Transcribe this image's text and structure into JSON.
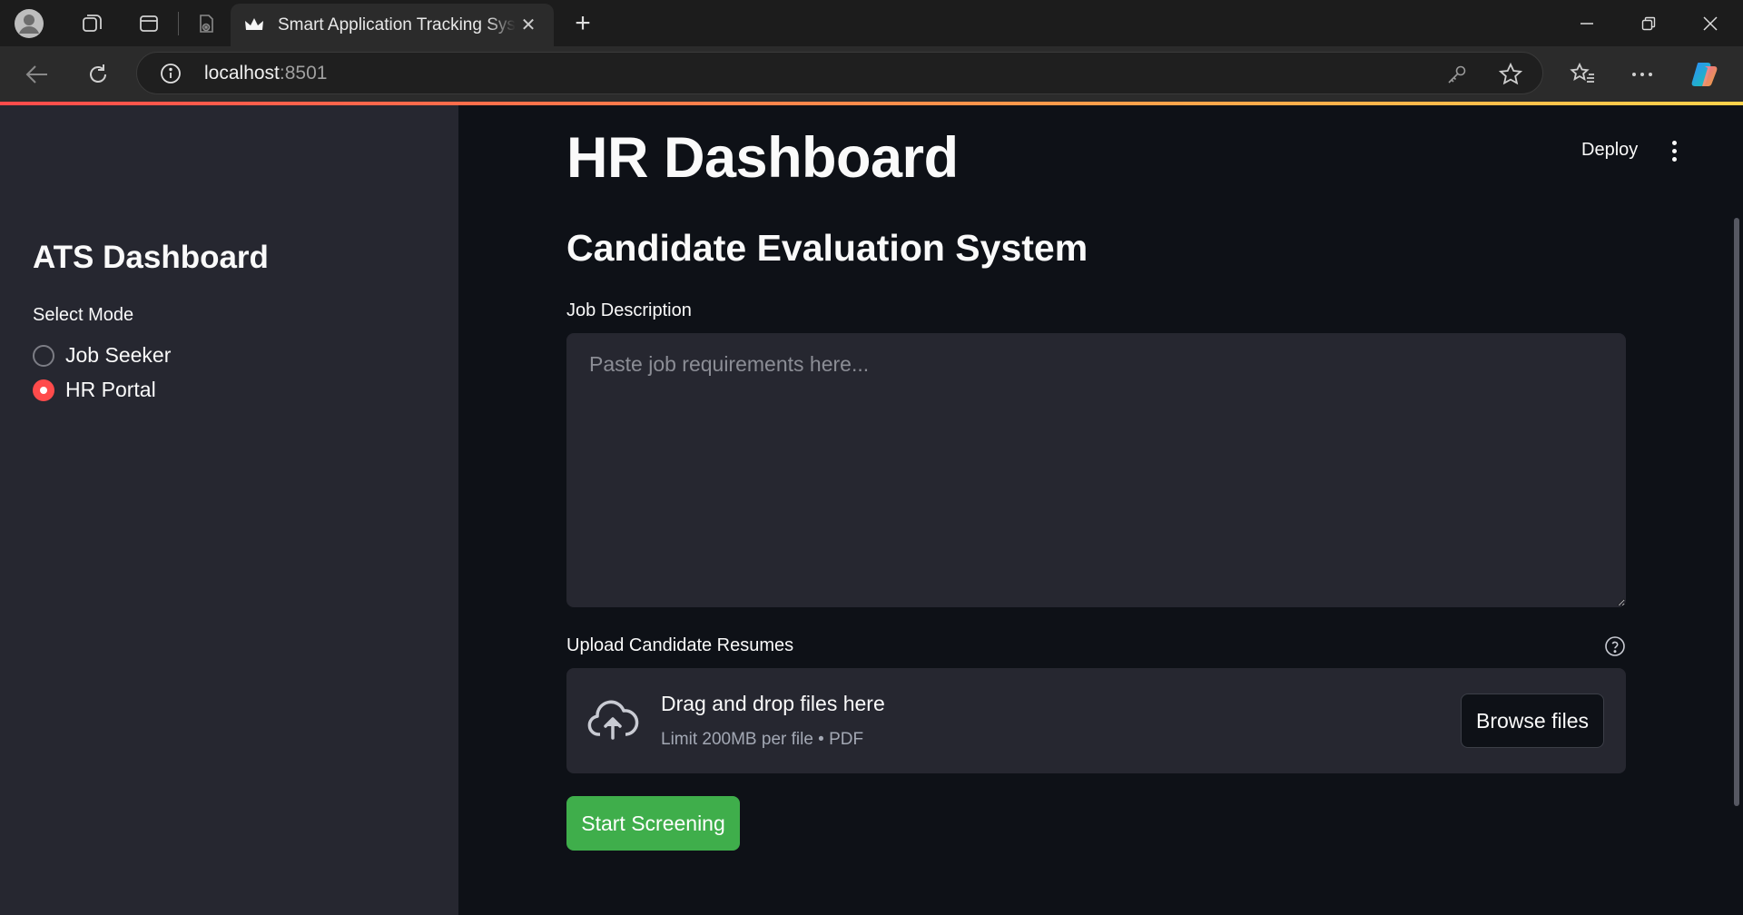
{
  "browser": {
    "tab_title": "Smart Application Tracking System",
    "url_host": "localhost",
    "url_port": ":8501"
  },
  "sidebar": {
    "title": "ATS Dashboard",
    "mode_label": "Select Mode",
    "options": [
      {
        "label": "Job Seeker",
        "selected": false
      },
      {
        "label": "HR Portal",
        "selected": true
      }
    ]
  },
  "header": {
    "deploy_label": "Deploy"
  },
  "main": {
    "title": "HR Dashboard",
    "subtitle": "Candidate Evaluation System",
    "job_description": {
      "label": "Job Description",
      "placeholder": "Paste job requirements here...",
      "value": ""
    },
    "upload": {
      "label": "Upload Candidate Resumes",
      "dropzone_title": "Drag and drop files here",
      "dropzone_hint": "Limit 200MB per file • PDF",
      "browse_label": "Browse files"
    },
    "start_label": "Start Screening"
  },
  "colors": {
    "accent_red": "#ff4b4b",
    "start_button_green": "#3fae4b",
    "app_background": "#0e1117",
    "sidebar_background": "#262730"
  }
}
